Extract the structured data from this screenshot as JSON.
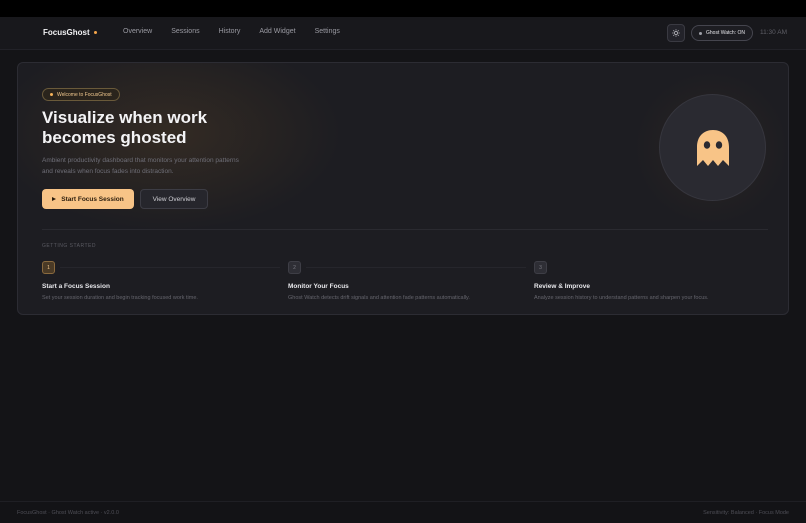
{
  "header": {
    "brand": "FocusGhost",
    "nav": [
      "Overview",
      "Sessions",
      "History",
      "Add Widget",
      "Settings"
    ],
    "ghost_watch": "Ghost Watch: ON",
    "time": "11:30 AM"
  },
  "hero": {
    "badge": "Welcome to FocusGhost",
    "title": "Visualize when work becomes ghosted",
    "description": "Ambient productivity dashboard that monitors your attention patterns and reveals when focus fades into distraction.",
    "primary_button": "Start Focus Session",
    "secondary_button": "View Overview"
  },
  "getting_started": {
    "label": "GETTING STARTED",
    "steps": [
      {
        "num": "1",
        "title": "Start a Focus Session",
        "desc": "Set your session duration and begin tracking focused work time."
      },
      {
        "num": "2",
        "title": "Monitor Your Focus",
        "desc": "Ghost Watch detects drift signals and attention fade patterns automatically."
      },
      {
        "num": "3",
        "title": "Review & Improve",
        "desc": "Analyze session history to understand patterns and sharpen your focus."
      }
    ]
  },
  "footer": {
    "left": "FocusGhost · Ghost Watch active · v2.0.0",
    "right": "Sensitivity: Balanced · Focus Mode"
  },
  "colors": {
    "accent": "#f8c487",
    "background": "#141417",
    "card": "#1d1d22"
  },
  "icons": {
    "theme": "sun-icon",
    "ghost": "ghost-icon",
    "play": "play-icon"
  }
}
